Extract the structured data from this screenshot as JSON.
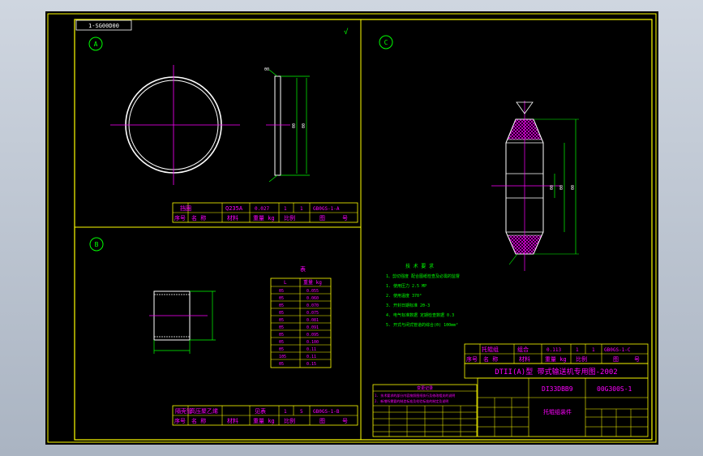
{
  "sheet_ref": "1-SG00D00",
  "views": {
    "a": "A",
    "b": "B",
    "c": "C"
  },
  "view_a": {
    "labels": [
      "θ0",
      "θ0",
      "θ0"
    ],
    "row1": [
      "挡圈",
      "Q235A",
      "0.027",
      "1",
      "1",
      "GB0GS-1-A"
    ],
    "header": [
      "序号",
      "名  称",
      "材料",
      "重量 kg",
      "比例",
      "图",
      "号"
    ]
  },
  "view_b": {
    "table_title": "表",
    "table_header": [
      "L",
      "重量 kg"
    ],
    "table_rows": [
      [
        "θ5",
        "0.055"
      ],
      [
        "θ5",
        "0.060"
      ],
      [
        "θ5",
        "0.070"
      ],
      [
        "θ5",
        "0.075"
      ],
      [
        "θ5",
        "0.081"
      ],
      [
        "θ5",
        "0.091"
      ],
      [
        "θ5",
        "0.095"
      ],
      [
        "θ5",
        "0.100"
      ],
      [
        "θ5",
        "0.11"
      ],
      [
        "1θ5",
        "0.11"
      ],
      [
        "θ5",
        "0.15"
      ]
    ],
    "row1": [
      "隔壳管",
      "高压聚乙烯",
      "见表",
      "1",
      "5",
      "GB0GS-1-B"
    ],
    "header": [
      "序号",
      "名  称",
      "材料",
      "重量 kg",
      "比例",
      "图",
      "号"
    ]
  },
  "view_c": {
    "dims": [
      "θ0",
      "θ0",
      "θ0"
    ]
  },
  "requirements": {
    "title": "技 术 要 求",
    "lines": [
      "1、剪切强度 配合图纸检查及必需的监督",
      "1. 使用压力    2.5 MP",
      "2. 使用温度    370°",
      "3. 开封日期标准    2θ-3",
      "4. 电气标准数据 定期检查数据 0.3",
      "5. 开式与闭式管道的综合(θ)  1θ0mm²"
    ]
  },
  "title_block": {
    "row1": [
      "托辊组",
      "组合",
      "0.113",
      "1",
      "1",
      "GB0GS-1-C"
    ],
    "header": [
      "序号",
      "名  称",
      "材料",
      "重量 kg",
      "比例",
      "图",
      "号"
    ],
    "banner": "DTII(A)型  带式输送机专用图-2002",
    "code": "DI33DBB9",
    "drawing_no": "00G300S-1",
    "name": "托辊组装件"
  },
  "revision_block": {
    "title": "变更记录",
    "lines": [
      "1. 技术要求的部分内容按照图纸执行及修改相关的说明",
      "2. 新增所需要的制造标准及检验标准的制定及说明"
    ]
  },
  "colors": {
    "background": "#000000",
    "frame": "#ffff00",
    "text": "#ff00ff",
    "line": "#ffffff",
    "center_line": "#ff00ff",
    "dimension": "#00ff00",
    "cad_bg": "#aab4c2"
  }
}
